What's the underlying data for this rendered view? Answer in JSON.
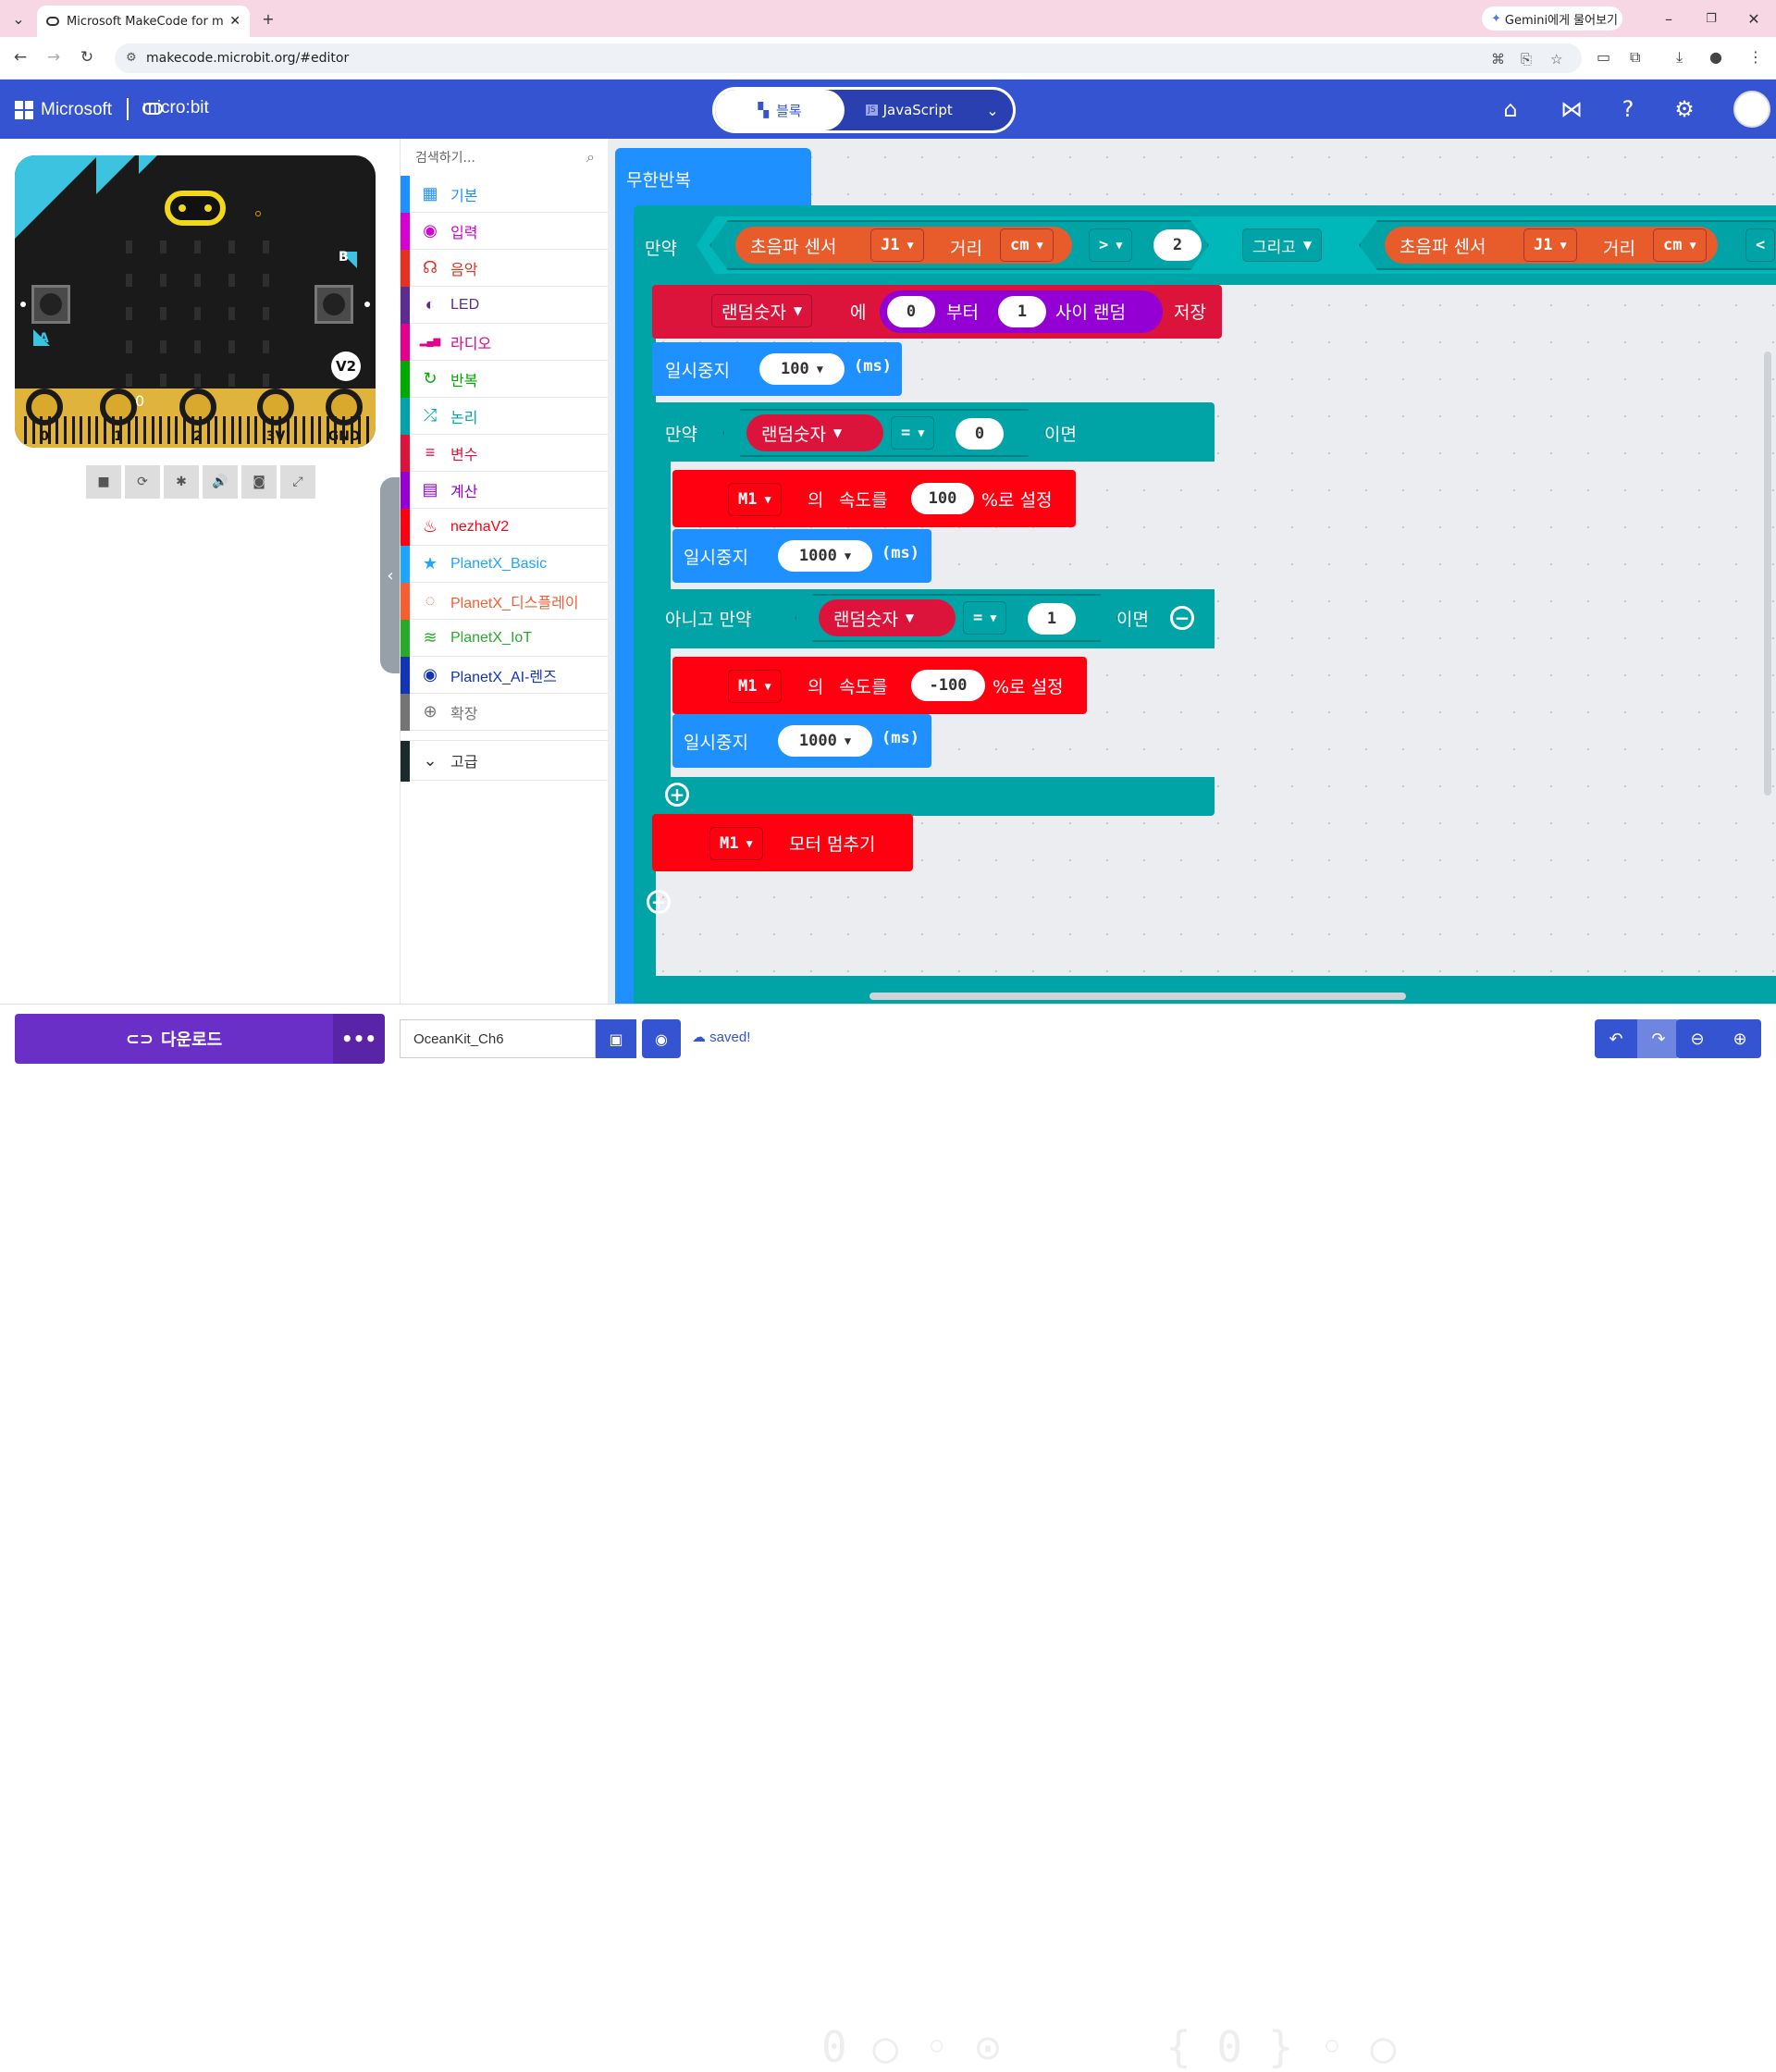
{
  "browser": {
    "tab_title": "Microsoft MakeCode for m",
    "gemini_label": "Gemini에게 물어보기",
    "url": "makecode.microbit.org/#editor"
  },
  "header": {
    "microsoft": "Microsoft",
    "microbit": "micro:bit",
    "blocks_label": "블록",
    "javascript_label": "JavaScript",
    "js_badge": "JS"
  },
  "simulator": {
    "pin_labels": [
      "0",
      "1",
      "2",
      "3V",
      "GND"
    ],
    "button_a": "A",
    "button_b": "B",
    "version_badge": "V2",
    "pin0_value": "0"
  },
  "toolbox": {
    "search_placeholder": "검색하기...",
    "categories": [
      {
        "label": "기본",
        "color": "#1e90ff",
        "icon": "grid-icon"
      },
      {
        "label": "입력",
        "color": "#d400d4",
        "icon": "circle-dot-icon"
      },
      {
        "label": "음악",
        "color": "#e63022",
        "icon": "headphones-icon"
      },
      {
        "label": "LED",
        "color": "#5c2d91",
        "icon": "toggle-icon"
      },
      {
        "label": "라디오",
        "color": "#e3008c",
        "icon": "signal-bars-icon"
      },
      {
        "label": "반복",
        "color": "#00aa00",
        "icon": "refresh-icon"
      },
      {
        "label": "논리",
        "color": "#00a4a6",
        "icon": "shuffle-icon"
      },
      {
        "label": "변수",
        "color": "#dc143c",
        "icon": "list-icon"
      },
      {
        "label": "계산",
        "color": "#9400d3",
        "icon": "calculator-icon"
      },
      {
        "label": "nezhaV2",
        "color": "#ff0011",
        "icon": "flame-icon"
      },
      {
        "label": "PlanetX_Basic",
        "color": "#1fa5ff",
        "icon": "star-icon"
      },
      {
        "label": "PlanetX_디스플레이",
        "color": "#f55e31",
        "icon": "dotted-circle-icon"
      },
      {
        "label": "PlanetX_IoT",
        "color": "#2aaa2a",
        "icon": "wifi-icon"
      },
      {
        "label": "PlanetX_AI-렌즈",
        "color": "#1234b6",
        "icon": "eye-icon"
      },
      {
        "label": "확장",
        "color": "#757575",
        "icon": "plus-circle-icon"
      }
    ],
    "advanced_label": "고급"
  },
  "workspace": {
    "forever": "무한반복",
    "if1": {
      "label": "만약",
      "sensor1": "초음파 센서",
      "pin": "J1",
      "distance": "거리",
      "unit": "cm",
      "op": ">",
      "threshold": "2",
      "and": "그리고",
      "sensor2": "초음파 센서",
      "pin2": "J1",
      "distance2": "거리",
      "unit2": "cm",
      "cut": "<"
    },
    "set_random": {
      "var": "랜덤숫자",
      "to": "에",
      "from_value": "0",
      "from": "부터",
      "to_value": "1",
      "between": "사이 랜덤",
      "save": "저장"
    },
    "pause1": {
      "label": "일시중지",
      "value": "100",
      "unit": "(ms)"
    },
    "if2": {
      "label": "만약",
      "var": "랜덤숫자",
      "op": "=",
      "value": "0",
      "then": "이면"
    },
    "motor1": {
      "motor": "M1",
      "of": "의",
      "speed": "속도를",
      "value": "100",
      "set": "%로 설정"
    },
    "pause2": {
      "label": "일시중지",
      "value": "1000",
      "unit": "(ms)"
    },
    "elseif": {
      "label": "아니고 만약",
      "var": "랜덤숫자",
      "op": "=",
      "value": "1",
      "then": "이면"
    },
    "motor2": {
      "motor": "M1",
      "of": "의",
      "speed": "속도를",
      "value": "-100",
      "set": "%로 설정"
    },
    "pause3": {
      "label": "일시중지",
      "value": "1000",
      "unit": "(ms)"
    },
    "stop": {
      "motor": "M1",
      "label": "모터 멈추기"
    }
  },
  "bottom": {
    "download": "다운로드",
    "more": "•••",
    "project_name": "OceanKit_Ch6",
    "status": "saved!"
  }
}
